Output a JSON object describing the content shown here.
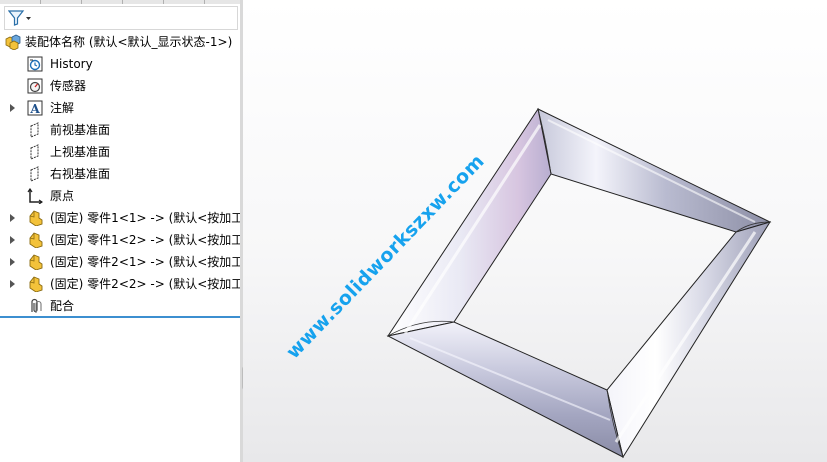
{
  "tree": {
    "root_label": "装配体名称 (默认<默认_显示状态-1>)",
    "items": [
      {
        "label": "History",
        "icon": "history-icon"
      },
      {
        "label": "传感器",
        "icon": "sensor-icon"
      },
      {
        "label": "注解",
        "icon": "annotation-icon"
      },
      {
        "label": "前视基准面",
        "icon": "plane-icon"
      },
      {
        "label": "上视基准面",
        "icon": "plane-icon"
      },
      {
        "label": "右视基准面",
        "icon": "plane-icon"
      },
      {
        "label": "原点",
        "icon": "origin-icon"
      },
      {
        "label": "(固定) 零件1<1> -> (默认<按加工:",
        "icon": "part-icon"
      },
      {
        "label": "(固定) 零件1<2> -> (默认<按加工:",
        "icon": "part-icon"
      },
      {
        "label": "(固定) 零件2<1> -> (默认<按加工:",
        "icon": "part-icon"
      },
      {
        "label": "(固定) 零件2<2> -> (默认<按加工:",
        "icon": "part-icon"
      },
      {
        "label": "配合",
        "icon": "mates-icon"
      }
    ]
  },
  "filter_icon": "filter-icon",
  "watermark": "www.solidworkszxw.com",
  "colors": {
    "accent": "#3c8fd0",
    "watermark": "#16a2ee",
    "part_yellow": "#f3c23a"
  }
}
